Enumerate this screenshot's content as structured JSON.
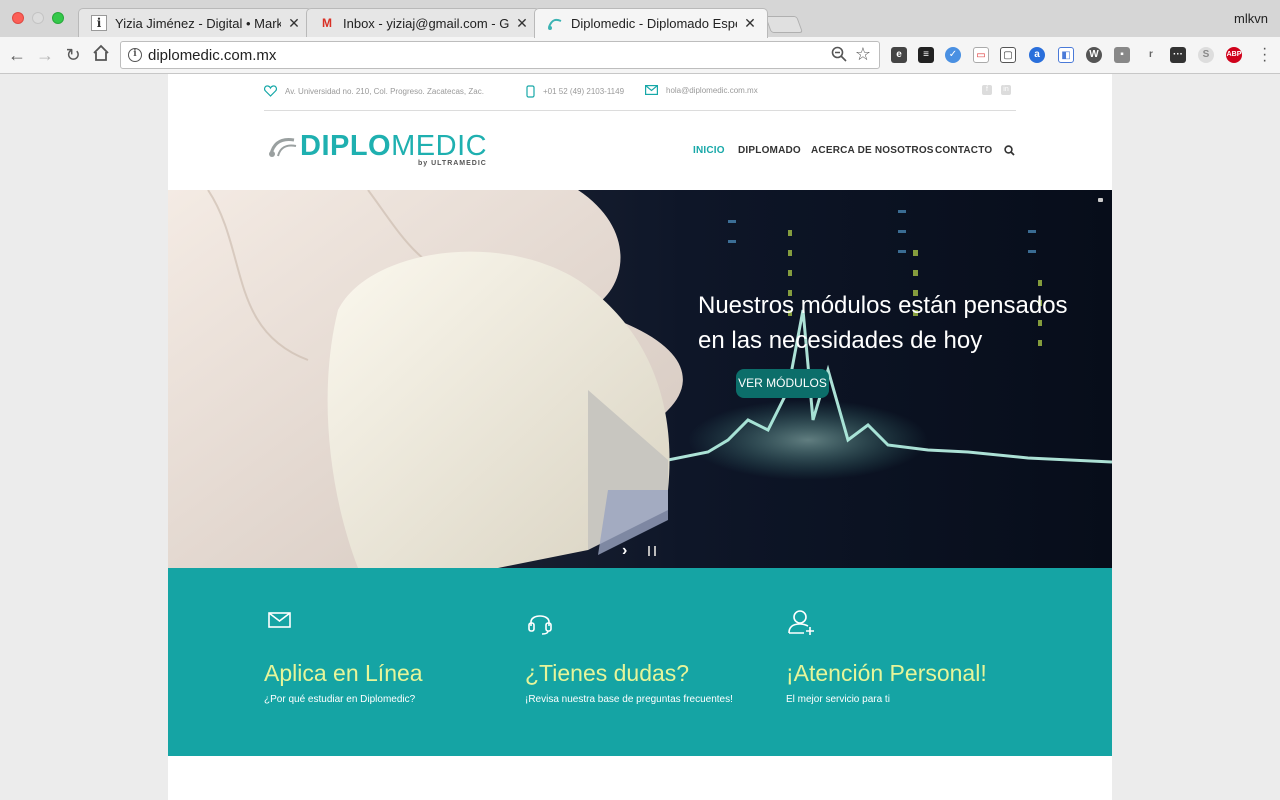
{
  "browser": {
    "tabs": [
      {
        "title": "Yizia Jiménez - Digital • Marke",
        "favicon": "i"
      },
      {
        "title": "Inbox - yiziaj@gmail.com - Gm",
        "favicon": "M"
      },
      {
        "title": "Diplomedic - Diplomado Espec",
        "favicon": "stethoscope"
      }
    ],
    "profile": "mlkvn",
    "url": "diplomedic.com.mx"
  },
  "site": {
    "topbar": {
      "address": "Av. Universidad no. 210, Col. Progreso. Zacatecas, Zac.",
      "phone": "+01 52 (49) 2103-1149",
      "email": "hola@diplomedic.com.mx"
    },
    "logo": {
      "bold": "DIPLO",
      "light": "MEDIC",
      "tagline": "by ULTRAMEDIC"
    },
    "nav": [
      "INICIO",
      "DIPLOMADO",
      "ACERCA DE NOSOTROS",
      "CONTACTO"
    ],
    "hero": {
      "headline": "Nuestros módulos están pensados en las necesidades de hoy",
      "cta": "VER MÓDULOS"
    },
    "features": [
      {
        "title": "Aplica en Línea",
        "subtitle": "¿Por qué estudiar en Diplomedic?",
        "icon": "envelope-icon"
      },
      {
        "title": "¿Tienes dudas?",
        "subtitle": "¡Revisa nuestra base de preguntas frecuentes!",
        "icon": "headset-icon"
      },
      {
        "title": "¡Atención Personal!",
        "subtitle": "El mejor servicio para ti",
        "icon": "add-user-icon"
      }
    ]
  },
  "colors": {
    "teal": "#15a4a4",
    "accent_yellow": "#e6f59a",
    "cta": "#0c6e6a"
  }
}
